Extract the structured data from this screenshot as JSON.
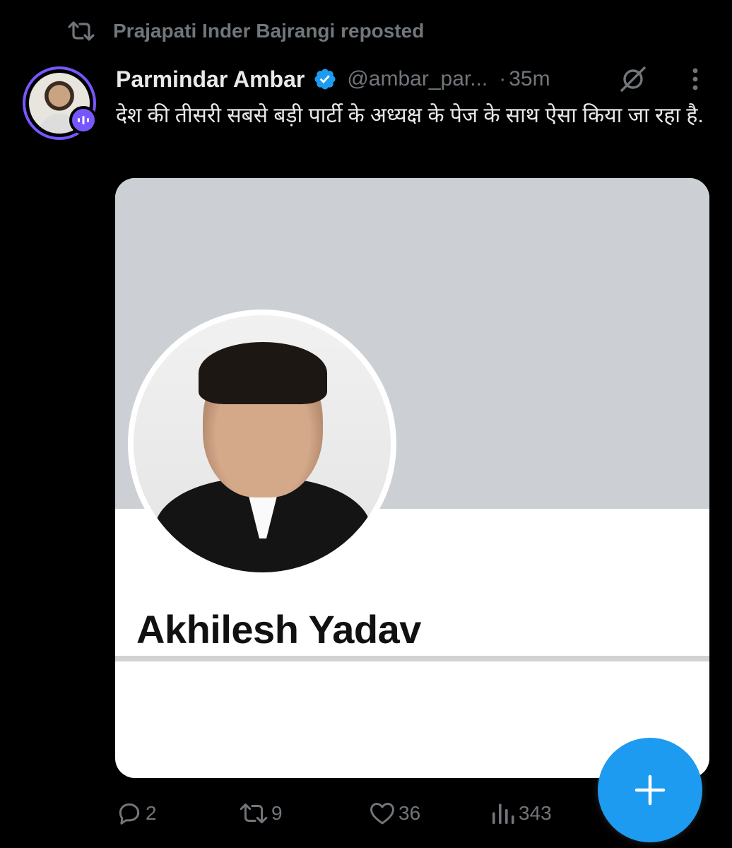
{
  "repost": {
    "text": "Prajapati Inder Bajrangi reposted",
    "icon": "repost-icon"
  },
  "tweet": {
    "author_name": "Parmindar Ambar",
    "handle": "@ambar_par...",
    "separator": "·",
    "time": "35m",
    "text": "देश की तीसरी सबसे बड़ी पार्टी के अध्यक्ष के पेज के साथ ऐसा किया जा रहा है."
  },
  "media": {
    "profile_name": "Akhilesh Yadav"
  },
  "actions": {
    "replies": "2",
    "reposts": "9",
    "likes": "36",
    "views": "343"
  },
  "colors": {
    "background": "#000000",
    "text": "#e7e9ea",
    "muted": "#71767b",
    "accent": "#1d9bf0",
    "avatar_ring": "#7856ff"
  }
}
